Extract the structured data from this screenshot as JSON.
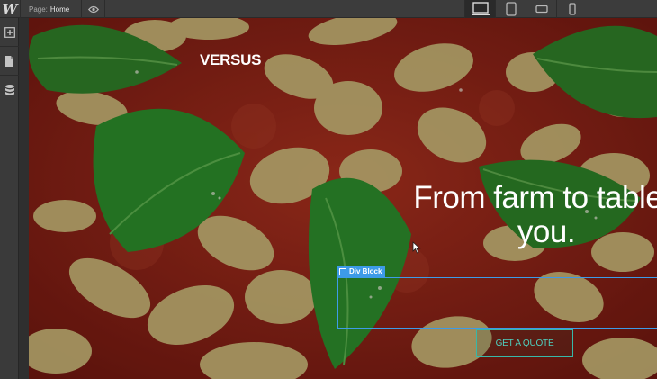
{
  "app": {
    "logo": "W"
  },
  "topbar": {
    "page_prefix": "Page:",
    "page_name": "Home",
    "preview_icon": "eye-icon",
    "devices": [
      {
        "name": "desktop",
        "icon": "desktop-icon",
        "active": true
      },
      {
        "name": "tablet",
        "icon": "tablet-icon",
        "active": false
      },
      {
        "name": "phone-landscape",
        "icon": "phone-landscape-icon",
        "active": false
      },
      {
        "name": "phone-portrait",
        "icon": "phone-portrait-icon",
        "active": false
      }
    ]
  },
  "leftbar": {
    "tools": [
      {
        "name": "add-elements",
        "icon": "plus-icon"
      },
      {
        "name": "pages",
        "icon": "page-icon"
      },
      {
        "name": "cms",
        "icon": "database-icon"
      }
    ]
  },
  "canvas": {
    "brand": "VERSUS",
    "headline": "From farm to table t\nyou.",
    "selected_element_label": "Div Block",
    "cta_label": "GET A QUOTE"
  },
  "colors": {
    "selection": "#3d9be8",
    "cta": "#38b8a8",
    "ui_dark": "#3c3c3c"
  }
}
